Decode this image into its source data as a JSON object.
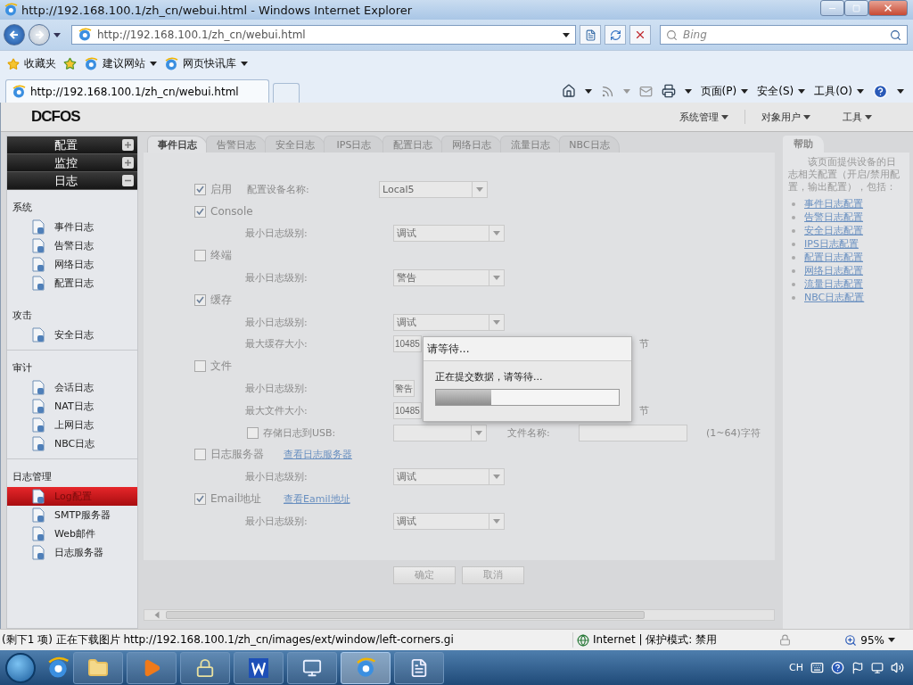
{
  "browser": {
    "title": "http://192.168.100.1/zh_cn/webui.html - Windows Internet Explorer",
    "address": "http://192.168.100.1/zh_cn/webui.html",
    "search_placeholder": "Bing",
    "favorites_label": "收藏夹",
    "favorites_links": [
      "建议网站",
      "网页快讯库"
    ],
    "tab_title": "http://192.168.100.1/zh_cn/webui.html",
    "commands": [
      "页面(P)",
      "安全(S)",
      "工具(O)"
    ]
  },
  "app": {
    "logo": "DCFOS",
    "top_menu": [
      "系统管理",
      "对象用户",
      "工具"
    ],
    "accordion": [
      {
        "label": "配置",
        "expanded": false
      },
      {
        "label": "监控",
        "expanded": false
      },
      {
        "label": "日志",
        "expanded": true
      }
    ],
    "nav_groups": [
      {
        "title": "系统",
        "items": [
          {
            "label": "事件日志",
            "selected": false
          },
          {
            "label": "告警日志",
            "selected": false
          },
          {
            "label": "网络日志",
            "selected": false
          },
          {
            "label": "配置日志",
            "selected": false
          }
        ]
      },
      {
        "title": "攻击",
        "items": [
          {
            "label": "安全日志",
            "selected": false
          }
        ]
      },
      {
        "title": "审计",
        "items": [
          {
            "label": "会话日志",
            "selected": false
          },
          {
            "label": "NAT日志",
            "selected": false
          },
          {
            "label": "上网日志",
            "selected": false
          },
          {
            "label": "NBC日志",
            "selected": false
          }
        ]
      },
      {
        "title": "日志管理",
        "items": [
          {
            "label": "Log配置",
            "selected": true
          },
          {
            "label": "SMTP服务器",
            "selected": false
          },
          {
            "label": "Web邮件",
            "selected": false
          },
          {
            "label": "日志服务器",
            "selected": false
          }
        ]
      }
    ],
    "tabs": [
      {
        "label": "事件日志",
        "selected": true
      },
      {
        "label": "告警日志",
        "selected": false
      },
      {
        "label": "安全日志",
        "selected": false
      },
      {
        "label": "IPS日志",
        "selected": false
      },
      {
        "label": "配置日志",
        "selected": false
      },
      {
        "label": "网络日志",
        "selected": false
      },
      {
        "label": "流量日志",
        "selected": false
      },
      {
        "label": "NBC日志",
        "selected": false
      }
    ],
    "rows": [
      {
        "kind": "toggle",
        "checked": true,
        "label": "启用",
        "field_label": "配置设备名称:",
        "field_value": "Local5"
      },
      {
        "kind": "toggle",
        "checked": true,
        "label": "Console"
      },
      {
        "kind": "select",
        "label": "最小日志级别:",
        "value": "调试"
      },
      {
        "kind": "toggle",
        "checked": false,
        "label": "终端"
      },
      {
        "kind": "select",
        "label": "最小日志级别:",
        "value": "警告"
      },
      {
        "kind": "toggle",
        "checked": true,
        "label": "缓存"
      },
      {
        "kind": "select",
        "label": "最小日志级别:",
        "value": "调试"
      },
      {
        "kind": "input",
        "label": "最大缓存大小:",
        "value": "10485",
        "unit": "节",
        "partial": true
      },
      {
        "kind": "toggle",
        "checked": false,
        "label": "文件"
      },
      {
        "kind": "select",
        "label": "最小日志级别:",
        "value": "警告",
        "partial": true
      },
      {
        "kind": "input",
        "label": "最大文件大小:",
        "value": "10485",
        "unit": "节",
        "partial": true
      },
      {
        "kind": "usb",
        "checked": false,
        "label": "存储日志到USB:",
        "filename_label": "文件名称:",
        "hint": "(1~64)字符"
      },
      {
        "kind": "toggle",
        "checked": false,
        "label": "日志服务器",
        "link": "查看日志服务器"
      },
      {
        "kind": "select",
        "label": "最小日志级别:",
        "value": "调试"
      },
      {
        "kind": "toggle",
        "checked": true,
        "label": "Email地址",
        "link": "查看Eamil地址"
      },
      {
        "kind": "select",
        "label": "最小日志级别:",
        "value": "调试"
      }
    ],
    "buttons": [
      "确定",
      "取消"
    ],
    "help": {
      "tab": "帮助",
      "text": "该页面提供设备的日志相关配置（开启/禁用配置，输出配置），包括：",
      "links": [
        "事件日志配置",
        "告警日志配置",
        "安全日志配置",
        "IPS日志配置",
        "配置日志配置",
        "网络日志配置",
        "流量日志配置",
        "NBC日志配置"
      ]
    }
  },
  "dialog": {
    "title": "请等待...",
    "message": "正在提交数据，请等待...",
    "level": 0.3
  },
  "status_bar": {
    "text": "(剩下1 项) 正在下载图片 http://192.168.100.1/zh_cn/images/ext/window/left-corners.gi",
    "zone": "Internet | 保护模式: 禁用",
    "zoom": "95%"
  },
  "taskbar": {
    "language": "CH"
  }
}
